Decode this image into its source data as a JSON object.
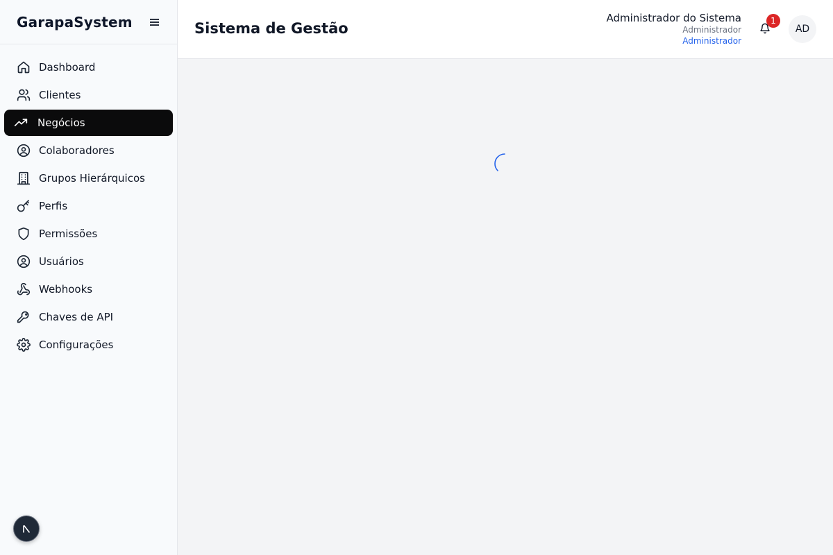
{
  "app": {
    "brand": "GarapaSystem"
  },
  "header": {
    "title": "Sistema de Gestão",
    "user_name": "Administrador do Sistema",
    "user_role": "Administrador",
    "user_group": "Administrador",
    "notification_count": "1",
    "avatar_initials": "AD"
  },
  "sidebar": {
    "items": [
      {
        "label": "Dashboard",
        "icon": "home-icon",
        "active": false
      },
      {
        "label": "Clientes",
        "icon": "users-icon",
        "active": false
      },
      {
        "label": "Negócios",
        "icon": "trending-up-icon",
        "active": true
      },
      {
        "label": "Colaboradores",
        "icon": "user-circle-icon",
        "active": false
      },
      {
        "label": "Grupos Hierárquicos",
        "icon": "building-icon",
        "active": false
      },
      {
        "label": "Perfis",
        "icon": "key-icon",
        "active": false
      },
      {
        "label": "Permissões",
        "icon": "shield-icon",
        "active": false
      },
      {
        "label": "Usuários",
        "icon": "user-circle-icon",
        "active": false
      },
      {
        "label": "Webhooks",
        "icon": "webhook-icon",
        "active": false
      },
      {
        "label": "Chaves de API",
        "icon": "key-round-icon",
        "active": false
      },
      {
        "label": "Configurações",
        "icon": "gear-icon",
        "active": false
      }
    ]
  },
  "main": {
    "state": "loading"
  },
  "colors": {
    "active_bg": "#0b0b0c",
    "badge": "#dc2626",
    "link": "#2563eb",
    "spinner": "#2563eb"
  }
}
